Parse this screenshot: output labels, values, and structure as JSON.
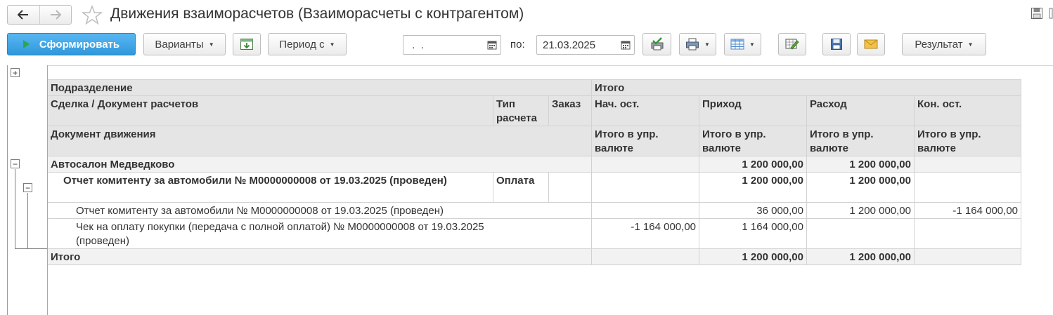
{
  "window": {
    "title": "Движения взаиморасчетов (Взаиморасчеты с контрагентом)"
  },
  "toolbar": {
    "generate_label": "Сформировать",
    "variants_label": "Варианты",
    "period_label": "Период с",
    "date_from_value": " .  .",
    "to_label": "по:",
    "date_to_value": "21.03.2025",
    "result_label": "Результат"
  },
  "icons": {
    "back": "arrow-left-icon",
    "forward": "arrow-right-icon",
    "favorite": "star-icon",
    "calendar": "calendar-icon",
    "print": "printer-icon",
    "save": "floppy-icon",
    "mail": "envelope-icon"
  },
  "colors": {
    "primary_button": "#3a9fe0",
    "header_bg": "#e5e5e5",
    "group_bg": "#f2f2f2"
  },
  "report": {
    "headers": {
      "division": "Подразделение",
      "total_top": "Итого",
      "deal_document": "Сделка / Документ расчетов",
      "settlement_type": "Тип расчета",
      "order": "Заказ",
      "opening_balance": "Нач. ост.",
      "income": "Приход",
      "expense": "Расход",
      "closing_balance": "Кон. ост.",
      "movement_document": "Документ движения",
      "total_currency_1": "Итого в упр. валюте",
      "total_currency_2": "Итого в упр. валюте",
      "total_currency_3": "Итого в упр. валюте",
      "total_currency_4": "Итого в упр. валюте"
    },
    "group": {
      "name": "Автосалон Медведково",
      "opening": "",
      "income": "1 200 000,00",
      "expense": "1 200 000,00",
      "closing": ""
    },
    "subgroup": {
      "name": "Отчет комитенту за автомобили № М0000000008 от 19.03.2025 (проведен)",
      "type": "Оплата",
      "order": "",
      "opening": "",
      "income": "1 200 000,00",
      "expense": "1 200 000,00",
      "closing": ""
    },
    "rows": [
      {
        "name": "Отчет комитенту за автомобили № М0000000008 от 19.03.2025 (проведен)",
        "opening": "",
        "income": "36 000,00",
        "expense": "1 200 000,00",
        "closing": "-1 164 000,00"
      },
      {
        "name": "Чек на оплату покупки (передача с полной оплатой) № М0000000008 от 19.03.2025 (проведен)",
        "opening": "-1 164 000,00",
        "income": "1 164 000,00",
        "expense": "",
        "closing": ""
      }
    ],
    "total": {
      "label": "Итого",
      "opening": "",
      "income": "1 200 000,00",
      "expense": "1 200 000,00",
      "closing": ""
    }
  }
}
